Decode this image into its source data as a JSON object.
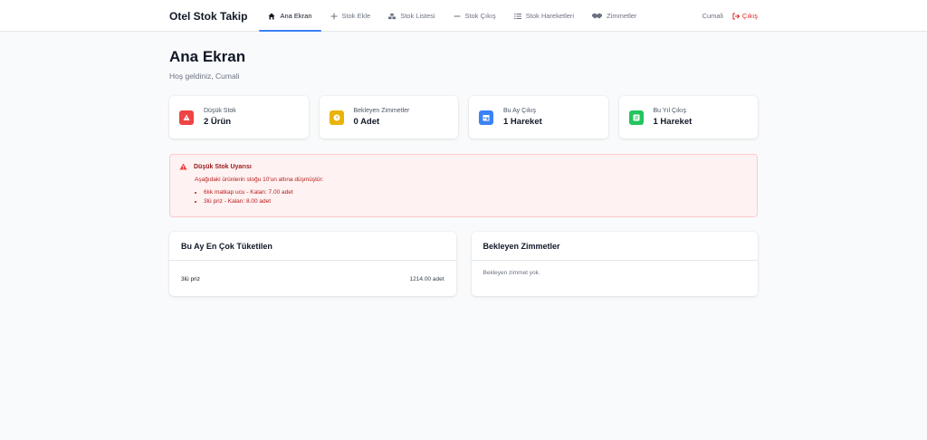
{
  "nav": {
    "brand": "Otel Stok Takip",
    "links": [
      {
        "label": "Ana Ekran",
        "icon": "home-icon",
        "active": true
      },
      {
        "label": "Stok Ekle",
        "icon": "plus-icon"
      },
      {
        "label": "Stok Listesi",
        "icon": "boxes-icon"
      },
      {
        "label": "Stok Çıkış",
        "icon": "minus-icon"
      },
      {
        "label": "Stok Hareketleri",
        "icon": "list-icon"
      },
      {
        "label": "Zimmetler",
        "icon": "handshake-icon"
      }
    ],
    "user": "Cumali",
    "logout": "Çıkış"
  },
  "page": {
    "title": "Ana Ekran",
    "subtitle": "Hoş geldiniz, Cumali"
  },
  "stats": [
    {
      "label": "Düşük Stok",
      "value": "2 Ürün",
      "color": "#ef4444",
      "icon": "warning-icon"
    },
    {
      "label": "Bekleyen Zimmetler",
      "value": "0 Adet",
      "color": "#eab308",
      "icon": "clock-icon"
    },
    {
      "label": "Bu Ay Çıkış",
      "value": "1 Hareket",
      "color": "#3b82f6",
      "icon": "calendar-icon"
    },
    {
      "label": "Bu Yıl Çıkış",
      "value": "1 Hareket",
      "color": "#22c55e",
      "icon": "exchange-icon"
    }
  ],
  "alert": {
    "title": "Düşük Stok Uyarısı",
    "text": "Aşağıdaki ürünlerin stoğu 10'un altına düşmüştür:",
    "items": [
      "6lık matkap ucu - Kalan: 7.00 adet",
      "3lü priz - Kalan: 8.00 adet"
    ]
  },
  "most_consumed": {
    "title": "Bu Ay En Çok Tüketilen",
    "rows": [
      {
        "name": "3lü priz",
        "qty": "1214.00 adet"
      }
    ]
  },
  "pending": {
    "title": "Bekleyen Zimmetler",
    "empty": "Bekleyen zimmet yok."
  }
}
